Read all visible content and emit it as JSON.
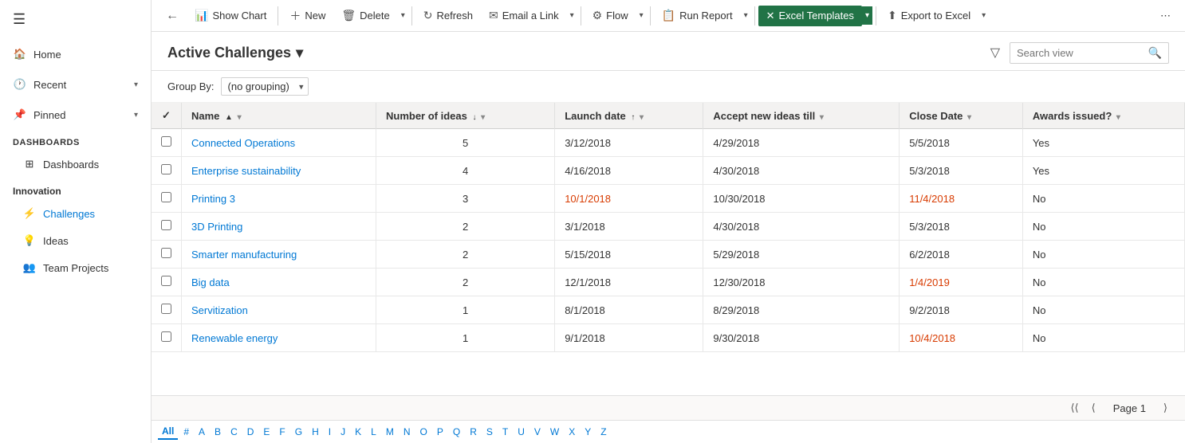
{
  "sidebar": {
    "hamburger": "☰",
    "items": [
      {
        "id": "home",
        "label": "Home",
        "icon": "🏠",
        "hasChevron": false
      },
      {
        "id": "recent",
        "label": "Recent",
        "icon": "🕐",
        "hasChevron": true
      },
      {
        "id": "pinned",
        "label": "Pinned",
        "icon": "📌",
        "hasChevron": true
      }
    ],
    "sections": [
      {
        "id": "dashboards",
        "label": "Dashboards",
        "sub_items": [
          {
            "id": "dashboards-sub",
            "label": "Dashboards",
            "icon": "⊞",
            "active": false
          }
        ]
      },
      {
        "id": "innovation",
        "label": "Innovation",
        "sub_items": [
          {
            "id": "challenges",
            "label": "Challenges",
            "icon": "⚡",
            "active": true
          },
          {
            "id": "ideas",
            "label": "Ideas",
            "icon": "💡",
            "active": false
          },
          {
            "id": "team-projects",
            "label": "Team Projects",
            "icon": "👥",
            "active": false
          }
        ]
      }
    ]
  },
  "toolbar": {
    "back_icon": "←",
    "show_chart_label": "Show Chart",
    "new_label": "New",
    "delete_label": "Delete",
    "refresh_label": "Refresh",
    "email_link_label": "Email a Link",
    "flow_label": "Flow",
    "run_report_label": "Run Report",
    "excel_templates_label": "Excel Templates",
    "export_excel_label": "Export to Excel",
    "more_icon": "⋯"
  },
  "header": {
    "title": "Active Challenges",
    "title_chevron": "▾",
    "filter_icon": "▽",
    "search_placeholder": "Search view",
    "search_icon": "🔍"
  },
  "group_by": {
    "label": "Group By:",
    "value": "(no grouping)"
  },
  "table": {
    "columns": [
      {
        "id": "checkbox",
        "label": ""
      },
      {
        "id": "name",
        "label": "Name",
        "sort": "▲",
        "filter": "▾"
      },
      {
        "id": "num_ideas",
        "label": "Number of ideas",
        "sort": "↓",
        "filter": "▾"
      },
      {
        "id": "launch_date",
        "label": "Launch date",
        "sort": "↑",
        "filter": "▾"
      },
      {
        "id": "accept_new_ideas",
        "label": "Accept new ideas till",
        "sort": "",
        "filter": "▾"
      },
      {
        "id": "close_date",
        "label": "Close Date",
        "sort": "",
        "filter": "▾"
      },
      {
        "id": "awards_issued",
        "label": "Awards issued?",
        "sort": "",
        "filter": "▾"
      }
    ],
    "rows": [
      {
        "name": "Connected Operations",
        "num_ideas": "5",
        "launch_date": "3/12/2018",
        "accept_new_ideas": "4/29/2018",
        "close_date": "5/5/2018",
        "awards_issued": "Yes",
        "name_link": true,
        "close_red": false
      },
      {
        "name": "Enterprise sustainability",
        "num_ideas": "4",
        "launch_date": "4/16/2018",
        "accept_new_ideas": "4/30/2018",
        "close_date": "5/3/2018",
        "awards_issued": "Yes",
        "name_link": true,
        "close_red": false
      },
      {
        "name": "Printing 3",
        "num_ideas": "3",
        "launch_date": "10/1/2018",
        "accept_new_ideas": "10/30/2018",
        "close_date": "11/4/2018",
        "awards_issued": "No",
        "name_link": true,
        "close_red": true,
        "launch_red": true
      },
      {
        "name": "3D Printing",
        "num_ideas": "2",
        "launch_date": "3/1/2018",
        "accept_new_ideas": "4/30/2018",
        "close_date": "5/3/2018",
        "awards_issued": "No",
        "name_link": true,
        "close_red": false
      },
      {
        "name": "Smarter manufacturing",
        "num_ideas": "2",
        "launch_date": "5/15/2018",
        "accept_new_ideas": "5/29/2018",
        "close_date": "6/2/2018",
        "awards_issued": "No",
        "name_link": true,
        "close_red": false
      },
      {
        "name": "Big data",
        "num_ideas": "2",
        "launch_date": "12/1/2018",
        "accept_new_ideas": "12/30/2018",
        "close_date": "1/4/2019",
        "awards_issued": "No",
        "name_link": true,
        "close_red": true
      },
      {
        "name": "Servitization",
        "num_ideas": "1",
        "launch_date": "8/1/2018",
        "accept_new_ideas": "8/29/2018",
        "close_date": "9/2/2018",
        "awards_issued": "No",
        "name_link": true,
        "close_red": false
      },
      {
        "name": "Renewable energy",
        "num_ideas": "1",
        "launch_date": "9/1/2018",
        "accept_new_ideas": "9/30/2018",
        "close_date": "10/4/2018",
        "awards_issued": "No",
        "name_link": true,
        "close_red": true
      }
    ]
  },
  "pagination": {
    "first_icon": "⟨⟨",
    "prev_icon": "⟨",
    "next_icon": "⟩",
    "page_label": "Page 1"
  },
  "alphabet": {
    "chars": [
      "All",
      "#",
      "A",
      "B",
      "C",
      "D",
      "E",
      "F",
      "G",
      "H",
      "I",
      "J",
      "K",
      "L",
      "M",
      "N",
      "O",
      "P",
      "Q",
      "R",
      "S",
      "T",
      "U",
      "V",
      "W",
      "X",
      "Y",
      "Z"
    ],
    "active": "All"
  },
  "colors": {
    "link": "#0078d4",
    "red": "#d83b01",
    "excel_green": "#217346"
  }
}
